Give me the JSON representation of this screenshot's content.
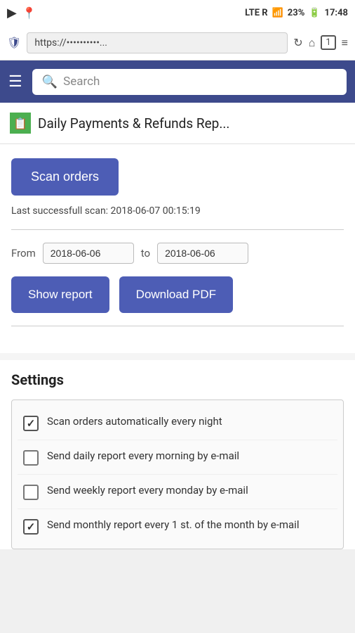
{
  "status_bar": {
    "signal": "LTE R",
    "battery": "23%",
    "time": "17:48"
  },
  "address_bar": {
    "url": "https://",
    "url_placeholder": "https://••••••••••..."
  },
  "app_header": {
    "search_placeholder": "Search"
  },
  "page_title": "Daily Payments & Refunds Rep...",
  "scan_orders": {
    "button_label": "Scan orders",
    "last_scan_label": "Last successfull scan: 2018-06-07 00:15:19"
  },
  "date_range": {
    "from_label": "From",
    "from_value": "2018-06-06",
    "to_label": "to",
    "to_value": "2018-06-06"
  },
  "action_buttons": {
    "show_report": "Show report",
    "download_pdf": "Download PDF"
  },
  "settings": {
    "title": "Settings",
    "items": [
      {
        "label": "Scan orders automatically every night",
        "checked": true
      },
      {
        "label": "Send daily report every morning by e-mail",
        "checked": false
      },
      {
        "label": "Send weekly report every monday by e-mail",
        "checked": false
      },
      {
        "label": "Send monthly report every 1 st. of the month by e-mail",
        "checked": true
      }
    ]
  }
}
